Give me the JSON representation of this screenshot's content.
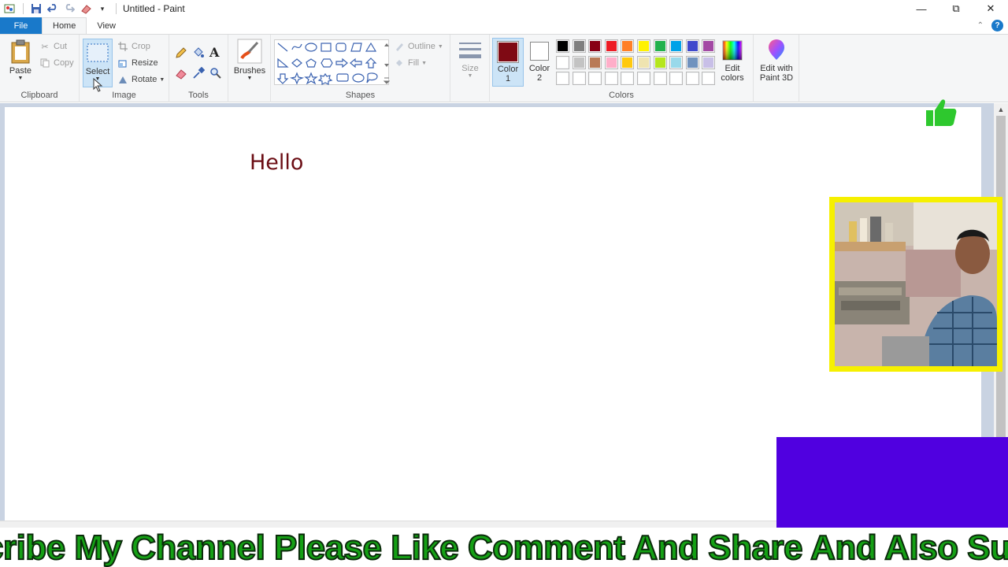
{
  "window": {
    "title": "Untitled - Paint",
    "controls": [
      "minimize",
      "restore",
      "close"
    ]
  },
  "tabs": {
    "file": "File",
    "home": "Home",
    "view": "View"
  },
  "ribbon": {
    "clipboard": {
      "label": "Clipboard",
      "paste": "Paste",
      "cut": "Cut",
      "copy": "Copy"
    },
    "image": {
      "label": "Image",
      "select": "Select",
      "crop": "Crop",
      "resize": "Resize",
      "rotate": "Rotate"
    },
    "tools": {
      "label": "Tools"
    },
    "brushes": {
      "label": "Brushes"
    },
    "shapes": {
      "label": "Shapes",
      "outline": "Outline",
      "fill": "Fill"
    },
    "size": {
      "label": "Size"
    },
    "colors": {
      "label": "Colors",
      "color1_label": "Color",
      "color1_num": "1",
      "color2_label": "Color",
      "color2_num": "2",
      "color1_value": "#7f0a14",
      "color2_value": "#ffffff",
      "edit_colors_line1": "Edit",
      "edit_colors_line2": "colors",
      "palette_row1": [
        "#000000",
        "#7f7f7f",
        "#880015",
        "#ed1c24",
        "#ff7f27",
        "#fff200",
        "#22b14c",
        "#00a2e8",
        "#3f48cc",
        "#a349a4"
      ],
      "palette_row2": [
        "#ffffff",
        "#c3c3c3",
        "#b97a57",
        "#ffaec9",
        "#ffc90e",
        "#efe4b0",
        "#b5e61d",
        "#99d9ea",
        "#7092be",
        "#c8bfe7"
      ],
      "palette_row3": [
        "#ffffff",
        "#ffffff",
        "#ffffff",
        "#ffffff",
        "#ffffff",
        "#ffffff",
        "#ffffff",
        "#ffffff",
        "#ffffff",
        "#ffffff"
      ]
    },
    "paint3d": {
      "line1": "Edit with",
      "line2": "Paint 3D"
    }
  },
  "canvas": {
    "text": "Hello"
  },
  "overlay": {
    "ticker": "cribe My Channel Please Like Comment And Share And Also Subsc",
    "accent_purple": "#5000e0",
    "frame_yellow": "#f6f000"
  }
}
